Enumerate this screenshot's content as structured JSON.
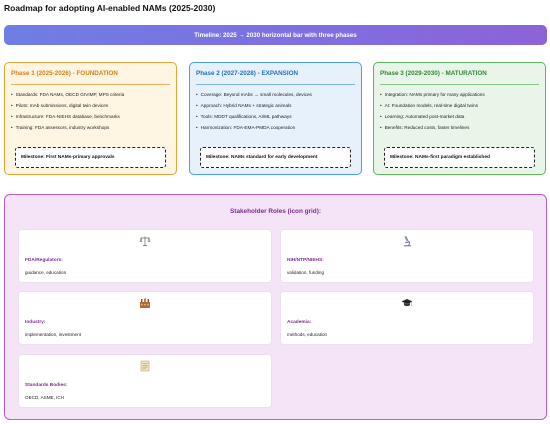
{
  "title": "Roadmap for adopting AI-enabled NAMs (2025-2030)",
  "timeline": "Timeline: 2025 → 2030 horizontal bar with three phases",
  "phases": [
    {
      "title": "Phase 1 (2025-2026) - FOUNDATION",
      "items": [
        "Standards: FDA NAMs, OECD GIVIMP, MPS criteria",
        "Pilots: mAb submissions, digital twin devices",
        "Infrastructure: FDA-NIEHS database, benchmarks",
        "Training: FDA assessors, industry workshops"
      ],
      "milestone": "Milestone: First NAMs-primary approvals"
    },
    {
      "title": "Phase 2 (2027-2028) - EXPANSION",
      "items": [
        "Coverage: Beyond mAbs → small molecules, devices",
        "Approach: Hybrid NAMs + strategic animals",
        "Tools: MDDT qualifications, AI/ML pathways",
        "Harmonization: FDA-EMA-PMDA cooperation"
      ],
      "milestone": "Milestone: NAMs standard for early development"
    },
    {
      "title": "Phase 3 (2029-2030) - MATURATION",
      "items": [
        "Integration: NAMs primary for many applications",
        "AI: Foundation models, real-time digital twins",
        "Learning: Automated post-market data",
        "Benefits: Reduced costs, faster timelines"
      ],
      "milestone": "Milestone: NAMs-first paradigm established"
    }
  ],
  "stakeholders": {
    "title": "Stakeholder Roles (icon grid):",
    "cards": [
      {
        "role": "FDA/Regulators:",
        "desc": "guidance, education",
        "icon": "scales-icon"
      },
      {
        "role": "NIH/NTP/NIEHS:",
        "desc": "validation, funding",
        "icon": "microscope-icon"
      },
      {
        "role": "Industry:",
        "desc": "implementation, investment",
        "icon": "factory-icon"
      },
      {
        "role": "Academia:",
        "desc": "methods, education",
        "icon": "graduation-cap-icon"
      },
      {
        "role": "Standards Bodies:",
        "desc": "OECD, ASME, ICH",
        "icon": "document-icon"
      }
    ]
  },
  "colors": {
    "phase1": "#e8a533",
    "phase2": "#4e9be8",
    "phase3": "#5cb85c",
    "stakeholder": "#b85ec6"
  }
}
